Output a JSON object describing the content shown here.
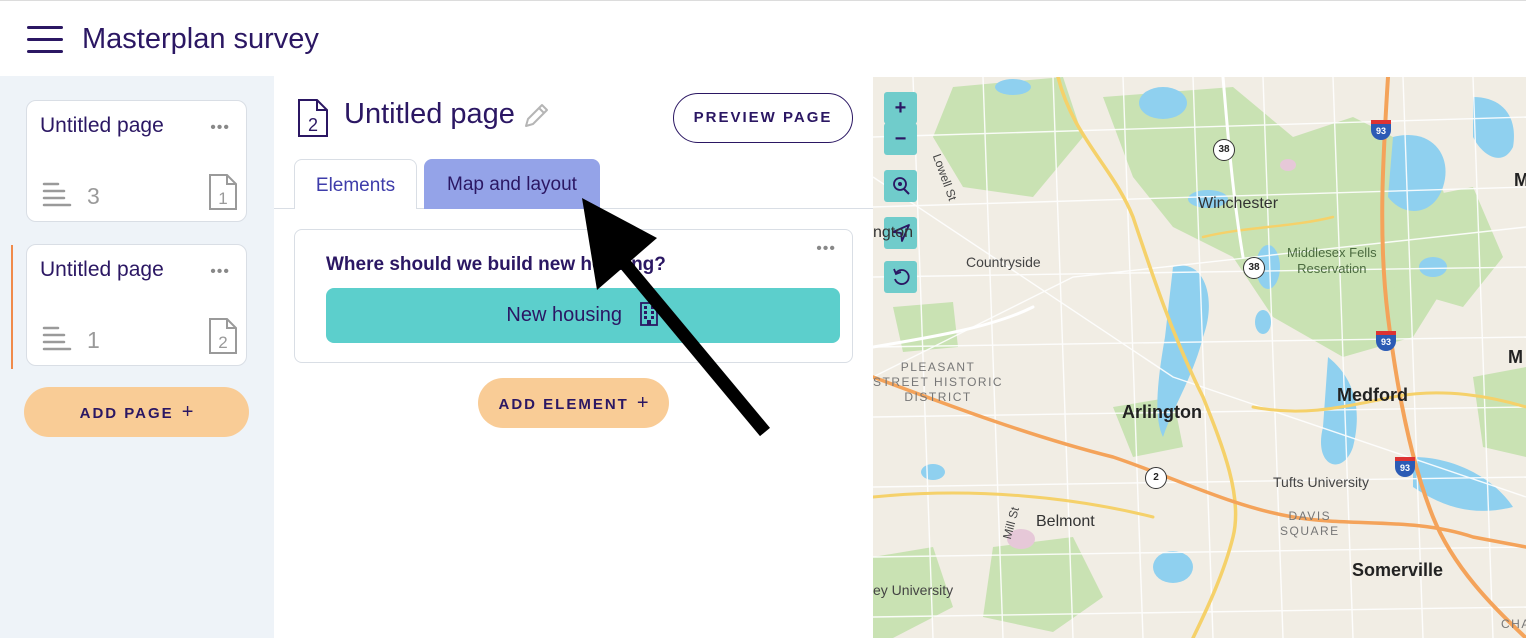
{
  "header": {
    "title": "Masterplan survey"
  },
  "sidebar": {
    "pages": [
      {
        "title": "Untitled page",
        "menu": "•••",
        "count": "3",
        "page_number": "1"
      },
      {
        "title": "Untitled page",
        "menu": "•••",
        "count": "1",
        "page_number": "2"
      }
    ],
    "add_page_label": "ADD PAGE",
    "add_page_plus": "+"
  },
  "editor": {
    "page_number": "2",
    "page_title": "Untitled page",
    "preview_label": "PREVIEW PAGE",
    "tabs": [
      {
        "label": "Elements",
        "active": false
      },
      {
        "label": "Map and layout",
        "active": true
      }
    ],
    "element": {
      "menu": "•••",
      "question": "Where should we build new housing?",
      "button_label": "New housing",
      "button_icon": "building-icon"
    },
    "add_element_label": "ADD ELEMENT",
    "add_element_plus": "+"
  },
  "map": {
    "controls": [
      "zoom-in",
      "zoom-out",
      "zoom-to-location",
      "locate-me",
      "reset-view"
    ],
    "zoom_in": "+",
    "zoom_out": "−",
    "labels": {
      "winchester": "Winchester",
      "arlington": "Arlington",
      "medford": "Medford",
      "belmont": "Belmont",
      "somerville": "Somerville",
      "countryside": "Countryside",
      "tufts": "Tufts University",
      "davis": "DAVIS\nSQUARE",
      "pleasant": "PLEASANT\nSTREET HISTORIC\nDISTRICT",
      "middlesex": "Middlesex Fells\nReservation",
      "lowell_st": "Lowell St",
      "mill_st": "Mill St",
      "ngton": "ngton",
      "ey_university": "ey University",
      "edge_m1": "M",
      "edge_m2": "M",
      "edge_cha": "CHA"
    },
    "shields": [
      "38",
      "38",
      "2"
    ],
    "interstates": [
      "93",
      "93",
      "93"
    ]
  },
  "colors": {
    "brand_dark": "#2b1763",
    "accent_orange": "#f9cc96",
    "accent_teal": "#5ccfcc",
    "tab_active": "#94a3e8",
    "sidebar_bg": "#eef3f8"
  }
}
